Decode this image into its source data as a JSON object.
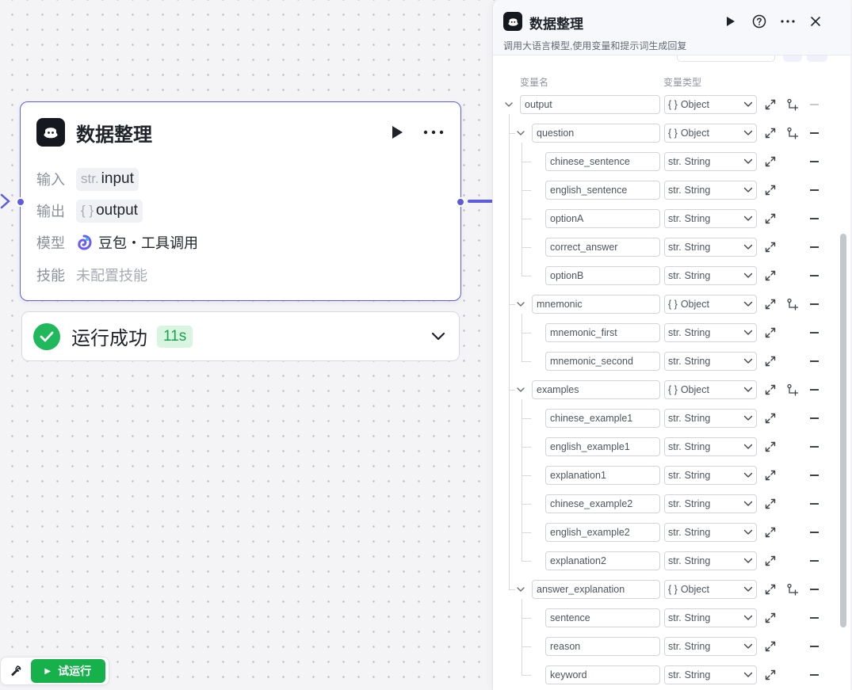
{
  "node": {
    "title": "数据整理",
    "input_label": "输入",
    "input_type": "str.",
    "input_name": "input",
    "output_label": "输出",
    "output_type": "{ }",
    "output_name": "output",
    "model_label": "模型",
    "model_name": "豆包・工具调用",
    "skill_label": "技能",
    "skill_value": "未配置技能",
    "icons": [
      "bot-icon",
      "play-icon",
      "more-icon"
    ]
  },
  "run_status": {
    "text": "运行成功",
    "time": "11s",
    "icons": [
      "check-icon",
      "chevron-down-icon"
    ]
  },
  "toolbar": {
    "tool_icon": "wrench-icon",
    "trial_label": "试运行"
  },
  "panel": {
    "title": "数据整理",
    "description": "调用大语言模型,使用变量和提示词生成回复",
    "col_name": "变量名",
    "col_type": "变量类型",
    "icons": [
      "bot-icon",
      "play-icon",
      "help-icon",
      "more-icon",
      "close-icon"
    ],
    "variables": [
      {
        "name": "output",
        "type": "Object",
        "type_icon": "{ }",
        "depth": 0,
        "expandable": true,
        "remove_disabled": true
      },
      {
        "name": "question",
        "type": "Object",
        "type_icon": "{ }",
        "depth": 1,
        "expandable": true,
        "remove_disabled": false
      },
      {
        "name": "chinese_sentence",
        "type": "String",
        "type_icon": "str.",
        "depth": 2,
        "expandable": false,
        "remove_disabled": false
      },
      {
        "name": "english_sentence",
        "type": "String",
        "type_icon": "str.",
        "depth": 2,
        "expandable": false,
        "remove_disabled": false
      },
      {
        "name": "optionA",
        "type": "String",
        "type_icon": "str.",
        "depth": 2,
        "expandable": false,
        "remove_disabled": false
      },
      {
        "name": "correct_answer",
        "type": "String",
        "type_icon": "str.",
        "depth": 2,
        "expandable": false,
        "remove_disabled": false
      },
      {
        "name": "optionB",
        "type": "String",
        "type_icon": "str.",
        "depth": 2,
        "expandable": false,
        "remove_disabled": false
      },
      {
        "name": "mnemonic",
        "type": "Object",
        "type_icon": "{ }",
        "depth": 1,
        "expandable": true,
        "remove_disabled": false
      },
      {
        "name": "mnemonic_first",
        "type": "String",
        "type_icon": "str.",
        "depth": 2,
        "expandable": false,
        "remove_disabled": false
      },
      {
        "name": "mnemonic_second",
        "type": "String",
        "type_icon": "str.",
        "depth": 2,
        "expandable": false,
        "remove_disabled": false
      },
      {
        "name": "examples",
        "type": "Object",
        "type_icon": "{ }",
        "depth": 1,
        "expandable": true,
        "remove_disabled": false
      },
      {
        "name": "chinese_example1",
        "type": "String",
        "type_icon": "str.",
        "depth": 2,
        "expandable": false,
        "remove_disabled": false
      },
      {
        "name": "english_example1",
        "type": "String",
        "type_icon": "str.",
        "depth": 2,
        "expandable": false,
        "remove_disabled": false
      },
      {
        "name": "explanation1",
        "type": "String",
        "type_icon": "str.",
        "depth": 2,
        "expandable": false,
        "remove_disabled": false
      },
      {
        "name": "chinese_example2",
        "type": "String",
        "type_icon": "str.",
        "depth": 2,
        "expandable": false,
        "remove_disabled": false
      },
      {
        "name": "english_example2",
        "type": "String",
        "type_icon": "str.",
        "depth": 2,
        "expandable": false,
        "remove_disabled": false
      },
      {
        "name": "explanation2",
        "type": "String",
        "type_icon": "str.",
        "depth": 2,
        "expandable": false,
        "remove_disabled": false
      },
      {
        "name": "answer_explanation",
        "type": "Object",
        "type_icon": "{ }",
        "depth": 1,
        "expandable": true,
        "remove_disabled": false
      },
      {
        "name": "sentence",
        "type": "String",
        "type_icon": "str.",
        "depth": 2,
        "expandable": false,
        "remove_disabled": false
      },
      {
        "name": "reason",
        "type": "String",
        "type_icon": "str.",
        "depth": 2,
        "expandable": false,
        "remove_disabled": false
      },
      {
        "name": "keyword",
        "type": "String",
        "type_icon": "str.",
        "depth": 2,
        "expandable": false,
        "remove_disabled": false
      }
    ]
  },
  "colors": {
    "accent": "#5b5ce0",
    "success": "#1fb85a",
    "trial_button": "#17b14c"
  }
}
